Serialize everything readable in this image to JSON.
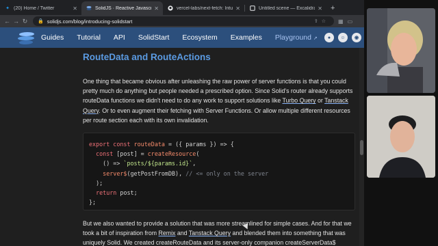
{
  "tabs": [
    {
      "title": "(20) Home / Twitter",
      "icon": "twitter-icon",
      "active": false
    },
    {
      "title": "SolidJS · Reactive Javascript L",
      "icon": "solid-icon",
      "active": true
    },
    {
      "title": "vercel-labs/next-fetch: Intuitiv",
      "icon": "github-icon",
      "active": false
    },
    {
      "title": "Untitled scene — Excalidraw P",
      "icon": "excalidraw-icon",
      "active": false
    }
  ],
  "address": {
    "url": "solidjs.com/blog/introducing-solidstart"
  },
  "nav": {
    "guides": "Guides",
    "tutorial": "Tutorial",
    "api": "API",
    "solidstart": "SolidStart",
    "ecosystem": "Ecosystem",
    "examples": "Examples",
    "playground": "Playground",
    "external_mark": "↗"
  },
  "article": {
    "heading": "RouteData and RouteActions",
    "p1": {
      "part1": "One thing that became obvious after unleashing the raw power of server functions is that you could pretty much do anything but people needed a prescribed option. Since Solid's router already supports routeData functions we didn't need to do any work to support solutions like ",
      "link1": "Turbo Query",
      "part2": " or ",
      "link2": "Tanstack Query",
      "part3": ". Or to even augment their fetching with Server Functions. Or allow multiple different resources per route section each with its own invalidation."
    },
    "code_lines": [
      "export const routeData = ({ params }) => {",
      "  const [post] = createResource(",
      "    () => `posts/${params.id}`,",
      "    server$(getPostFromDB), // <= only on the server",
      "  );",
      "  return post;",
      "};"
    ],
    "p2": {
      "part1": "But we also wanted to provide a solution that was more streamlined for simple cases. And for that we took a bit of inspiration from ",
      "link1": "Remix",
      "part2": " and ",
      "link2": "Tanstack Query",
      "part3": " and blended them into something that was uniquely Solid. We created createRouteData and its server-only companion createServerData$"
    }
  },
  "colors": {
    "header": "#2c4f7c",
    "heading": "#5b9be3",
    "background": "#1f1f1f"
  }
}
